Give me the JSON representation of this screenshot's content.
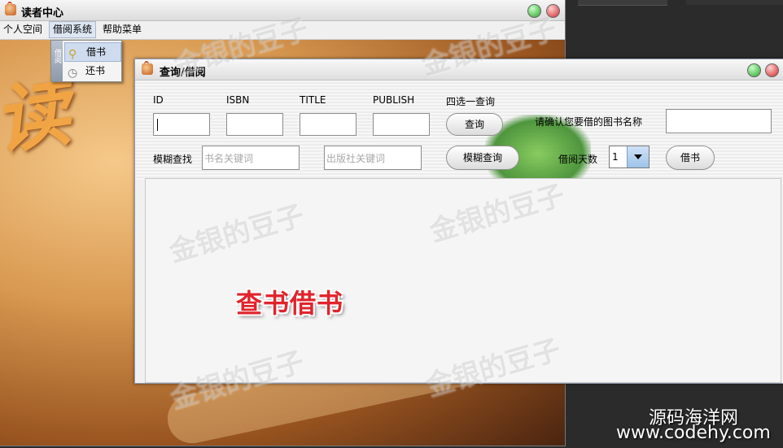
{
  "main_window": {
    "title": "读者中心",
    "menus": [
      "个人空间",
      "借阅系统",
      "帮助菜单"
    ],
    "popup_items": [
      {
        "label": "借书",
        "icon": "key-icon"
      },
      {
        "label": "还书",
        "icon": "clock-icon"
      }
    ],
    "background_text": "读",
    "popup_side_text": "借阅"
  },
  "inner_window": {
    "title": "查询/借阅",
    "columns": [
      "ID",
      "ISBN",
      "TITLE",
      "PUBLISH"
    ],
    "query_hint": "四选一查询",
    "query_button": "查询",
    "confirm_label": "请确认您要借的图书名称",
    "fuzzy_label": "模糊查找",
    "book_keyword_placeholder": "书名关键词",
    "publisher_keyword_placeholder": "出版社关键词",
    "fuzzy_button": "模糊查询",
    "days_label": "借阅天数",
    "days_value": "1",
    "borrow_button": "借书"
  },
  "overlay_caption": "查书借书",
  "watermark": "金银的豆子",
  "brand": {
    "line1": "源码海洋网",
    "line2": "www.codehy.com"
  },
  "colors": {
    "overlay_red": "#e0242c",
    "selection": "#cfdcef"
  }
}
